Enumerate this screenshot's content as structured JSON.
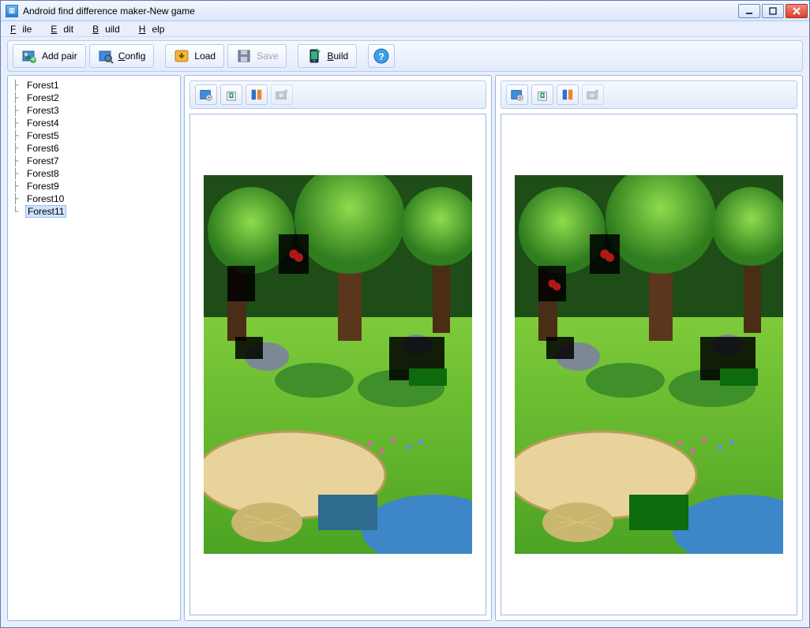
{
  "window": {
    "title": "Android find difference maker-New game"
  },
  "menu": {
    "file": "File",
    "edit": "Edit",
    "build": "Build",
    "help": "Help"
  },
  "toolbar": {
    "add_pair": "Add pair",
    "config": "Config",
    "load": "Load",
    "save": "Save",
    "build": "Build"
  },
  "sidebar": {
    "items": [
      "Forest1",
      "Forest2",
      "Forest3",
      "Forest4",
      "Forest5",
      "Forest6",
      "Forest7",
      "Forest8",
      "Forest9",
      "Forest10",
      "Forest11"
    ],
    "selected_index": 10
  },
  "panels": {
    "left_icons": [
      "image-settings-icon",
      "recycle-icon",
      "compare-icon",
      "camera-icon"
    ],
    "right_icons": [
      "image-settings-icon",
      "recycle-icon",
      "compare-icon",
      "camera-icon"
    ]
  }
}
